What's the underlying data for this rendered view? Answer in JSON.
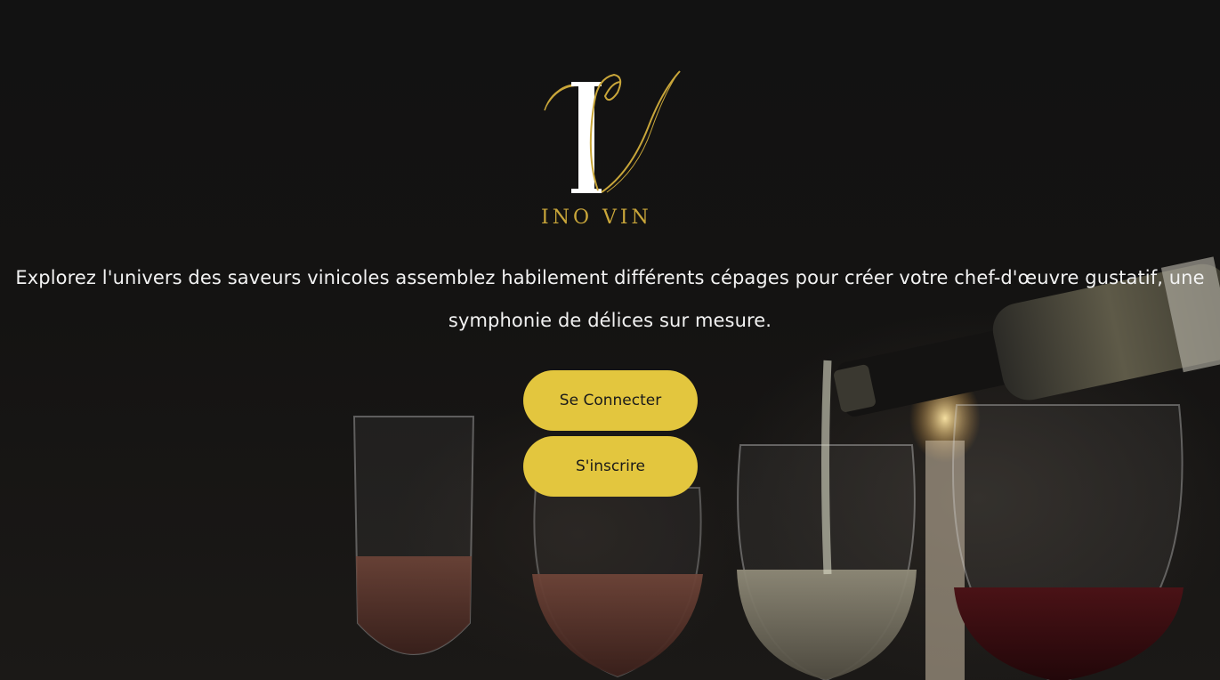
{
  "brand": {
    "logo_letters": "IV",
    "wordmark": "INO VIN"
  },
  "hero": {
    "tagline": "Explorez l'univers des saveurs vinicoles assemblez habilement différents cépages pour créer votre chef-d'œuvre gustatif, une symphonie de délices sur mesure."
  },
  "actions": {
    "login_label": "Se Connecter",
    "signup_label": "S'inscrire"
  },
  "colors": {
    "accent": "#e3c63e",
    "background": "#111111",
    "text": "#f2f2f2",
    "logo_gold": "#c9a63a"
  }
}
